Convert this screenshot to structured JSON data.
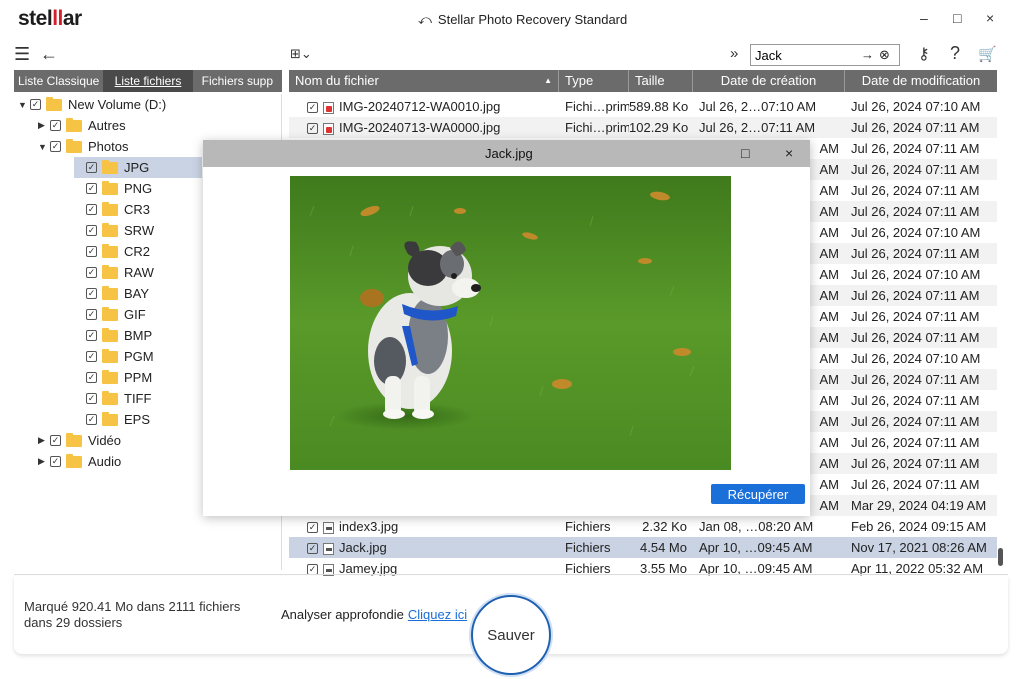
{
  "app": {
    "logo_prefix": "stel",
    "logo_mark": "ll",
    "logo_suffix": "ar",
    "title": "Stellar Photo Recovery Standard",
    "brand_color": "#d4202a",
    "accent_color": "#1b6fd8"
  },
  "window_controls": {
    "minimize": "–",
    "maximize": "□",
    "close": "×"
  },
  "toolbar": {
    "menu_icon": "☰",
    "back_icon": "←",
    "view_icon": "⊞⌄",
    "expand_icon": "»",
    "search_value": "Jack",
    "search_go_icon": "→",
    "search_clear_icon": "⊗",
    "key_icon": "⚷",
    "help_icon": "?",
    "cart_icon": "🛒"
  },
  "left_tabs": [
    "Liste Classique",
    "Liste fichiers",
    "Fichiers supp"
  ],
  "tree": [
    {
      "label": "New Volume (D:)",
      "level": 0,
      "caret": "▼",
      "selected": false
    },
    {
      "label": "Autres",
      "level": 1,
      "caret": "▶",
      "selected": false
    },
    {
      "label": "Photos",
      "level": 1,
      "caret": "▼",
      "selected": false
    },
    {
      "label": "JPG",
      "level": 2,
      "caret": "",
      "selected": true
    },
    {
      "label": "PNG",
      "level": 2,
      "caret": "",
      "selected": false
    },
    {
      "label": "CR3",
      "level": 2,
      "caret": "",
      "selected": false
    },
    {
      "label": "SRW",
      "level": 2,
      "caret": "",
      "selected": false
    },
    {
      "label": "CR2",
      "level": 2,
      "caret": "",
      "selected": false
    },
    {
      "label": "RAW",
      "level": 2,
      "caret": "",
      "selected": false
    },
    {
      "label": "BAY",
      "level": 2,
      "caret": "",
      "selected": false
    },
    {
      "label": "GIF",
      "level": 2,
      "caret": "",
      "selected": false
    },
    {
      "label": "BMP",
      "level": 2,
      "caret": "",
      "selected": false
    },
    {
      "label": "PGM",
      "level": 2,
      "caret": "",
      "selected": false
    },
    {
      "label": "PPM",
      "level": 2,
      "caret": "",
      "selected": false
    },
    {
      "label": "TIFF",
      "level": 2,
      "caret": "",
      "selected": false
    },
    {
      "label": "EPS",
      "level": 2,
      "caret": "",
      "selected": false
    },
    {
      "label": "Vidéo",
      "level": 1,
      "caret": "▶",
      "selected": false
    },
    {
      "label": "Audio",
      "level": 1,
      "caret": "▶",
      "selected": false
    }
  ],
  "table": {
    "columns": [
      "Nom du fichier",
      "Type",
      "Taille",
      "Date de création",
      "Date de modification"
    ],
    "sort_icon": "▲",
    "top_rows": [
      {
        "name": "IMG-20240712-WA0010.jpg",
        "type": "Fichi…primé",
        "size": "589.88 Ko",
        "created": "Jul 26, 2…07:10 AM",
        "modified": "Jul 26, 2024 07:10 AM",
        "icon": "red"
      },
      {
        "name": "IMG-20240713-WA0000.jpg",
        "type": "Fichi…primé",
        "size": "102.29 Ko",
        "created": "Jul 26, 2…07:11 AM",
        "modified": "Jul 26, 2024 07:11 AM",
        "icon": "red"
      }
    ],
    "hidden_rows": [
      {
        "created_tail": "AM",
        "modified": "Jul 26, 2024 07:11 AM"
      },
      {
        "created_tail": "AM",
        "modified": "Jul 26, 2024 07:11 AM"
      },
      {
        "created_tail": "AM",
        "modified": "Jul 26, 2024 07:11 AM"
      },
      {
        "created_tail": "AM",
        "modified": "Jul 26, 2024 07:11 AM"
      },
      {
        "created_tail": "AM",
        "modified": "Jul 26, 2024 07:10 AM"
      },
      {
        "created_tail": "AM",
        "modified": "Jul 26, 2024 07:11 AM"
      },
      {
        "created_tail": "AM",
        "modified": "Jul 26, 2024 07:10 AM"
      },
      {
        "created_tail": "AM",
        "modified": "Jul 26, 2024 07:11 AM"
      },
      {
        "created_tail": "AM",
        "modified": "Jul 26, 2024 07:11 AM"
      },
      {
        "created_tail": "AM",
        "modified": "Jul 26, 2024 07:11 AM"
      },
      {
        "created_tail": "AM",
        "modified": "Jul 26, 2024 07:10 AM"
      },
      {
        "created_tail": "AM",
        "modified": "Jul 26, 2024 07:11 AM"
      },
      {
        "created_tail": "AM",
        "modified": "Jul 26, 2024 07:11 AM"
      },
      {
        "created_tail": "AM",
        "modified": "Jul 26, 2024 07:11 AM"
      },
      {
        "created_tail": "AM",
        "modified": "Jul 26, 2024 07:11 AM"
      },
      {
        "created_tail": "AM",
        "modified": "Jul 26, 2024 07:11 AM"
      },
      {
        "created_tail": "AM",
        "modified": "Jul 26, 2024 07:11 AM"
      },
      {
        "created_tail": "AM",
        "modified": "Mar 29, 2024 04:19 AM"
      }
    ],
    "bottom_rows": [
      {
        "name": "index3.jpg",
        "type": "Fichiers",
        "size": "2.32 Ko",
        "created": "Jan 08, …08:20 AM",
        "modified": "Feb 26, 2024 09:15 AM",
        "selected": false
      },
      {
        "name": "Jack.jpg",
        "type": "Fichiers",
        "size": "4.54 Mo",
        "created": "Apr 10, …09:45 AM",
        "modified": "Nov 17, 2021 08:26 AM",
        "selected": true
      },
      {
        "name": "Jamey.jpg",
        "type": "Fichiers",
        "size": "3.55 Mo",
        "created": "Apr 10, …09:45 AM",
        "modified": "Apr 11, 2022 05:32 AM",
        "selected": false
      }
    ]
  },
  "preview": {
    "title": "Jack.jpg",
    "maximize": "□",
    "close": "×",
    "recover_label": "Récupérer"
  },
  "footer": {
    "status_line1": "Marqué 920.41 Mo dans 2111 fichiers",
    "status_line2": "dans 29 dossiers",
    "deep_scan_label": "Analyser approfondie",
    "deep_scan_link": "Cliquez ici",
    "save_label": "Sauver"
  }
}
